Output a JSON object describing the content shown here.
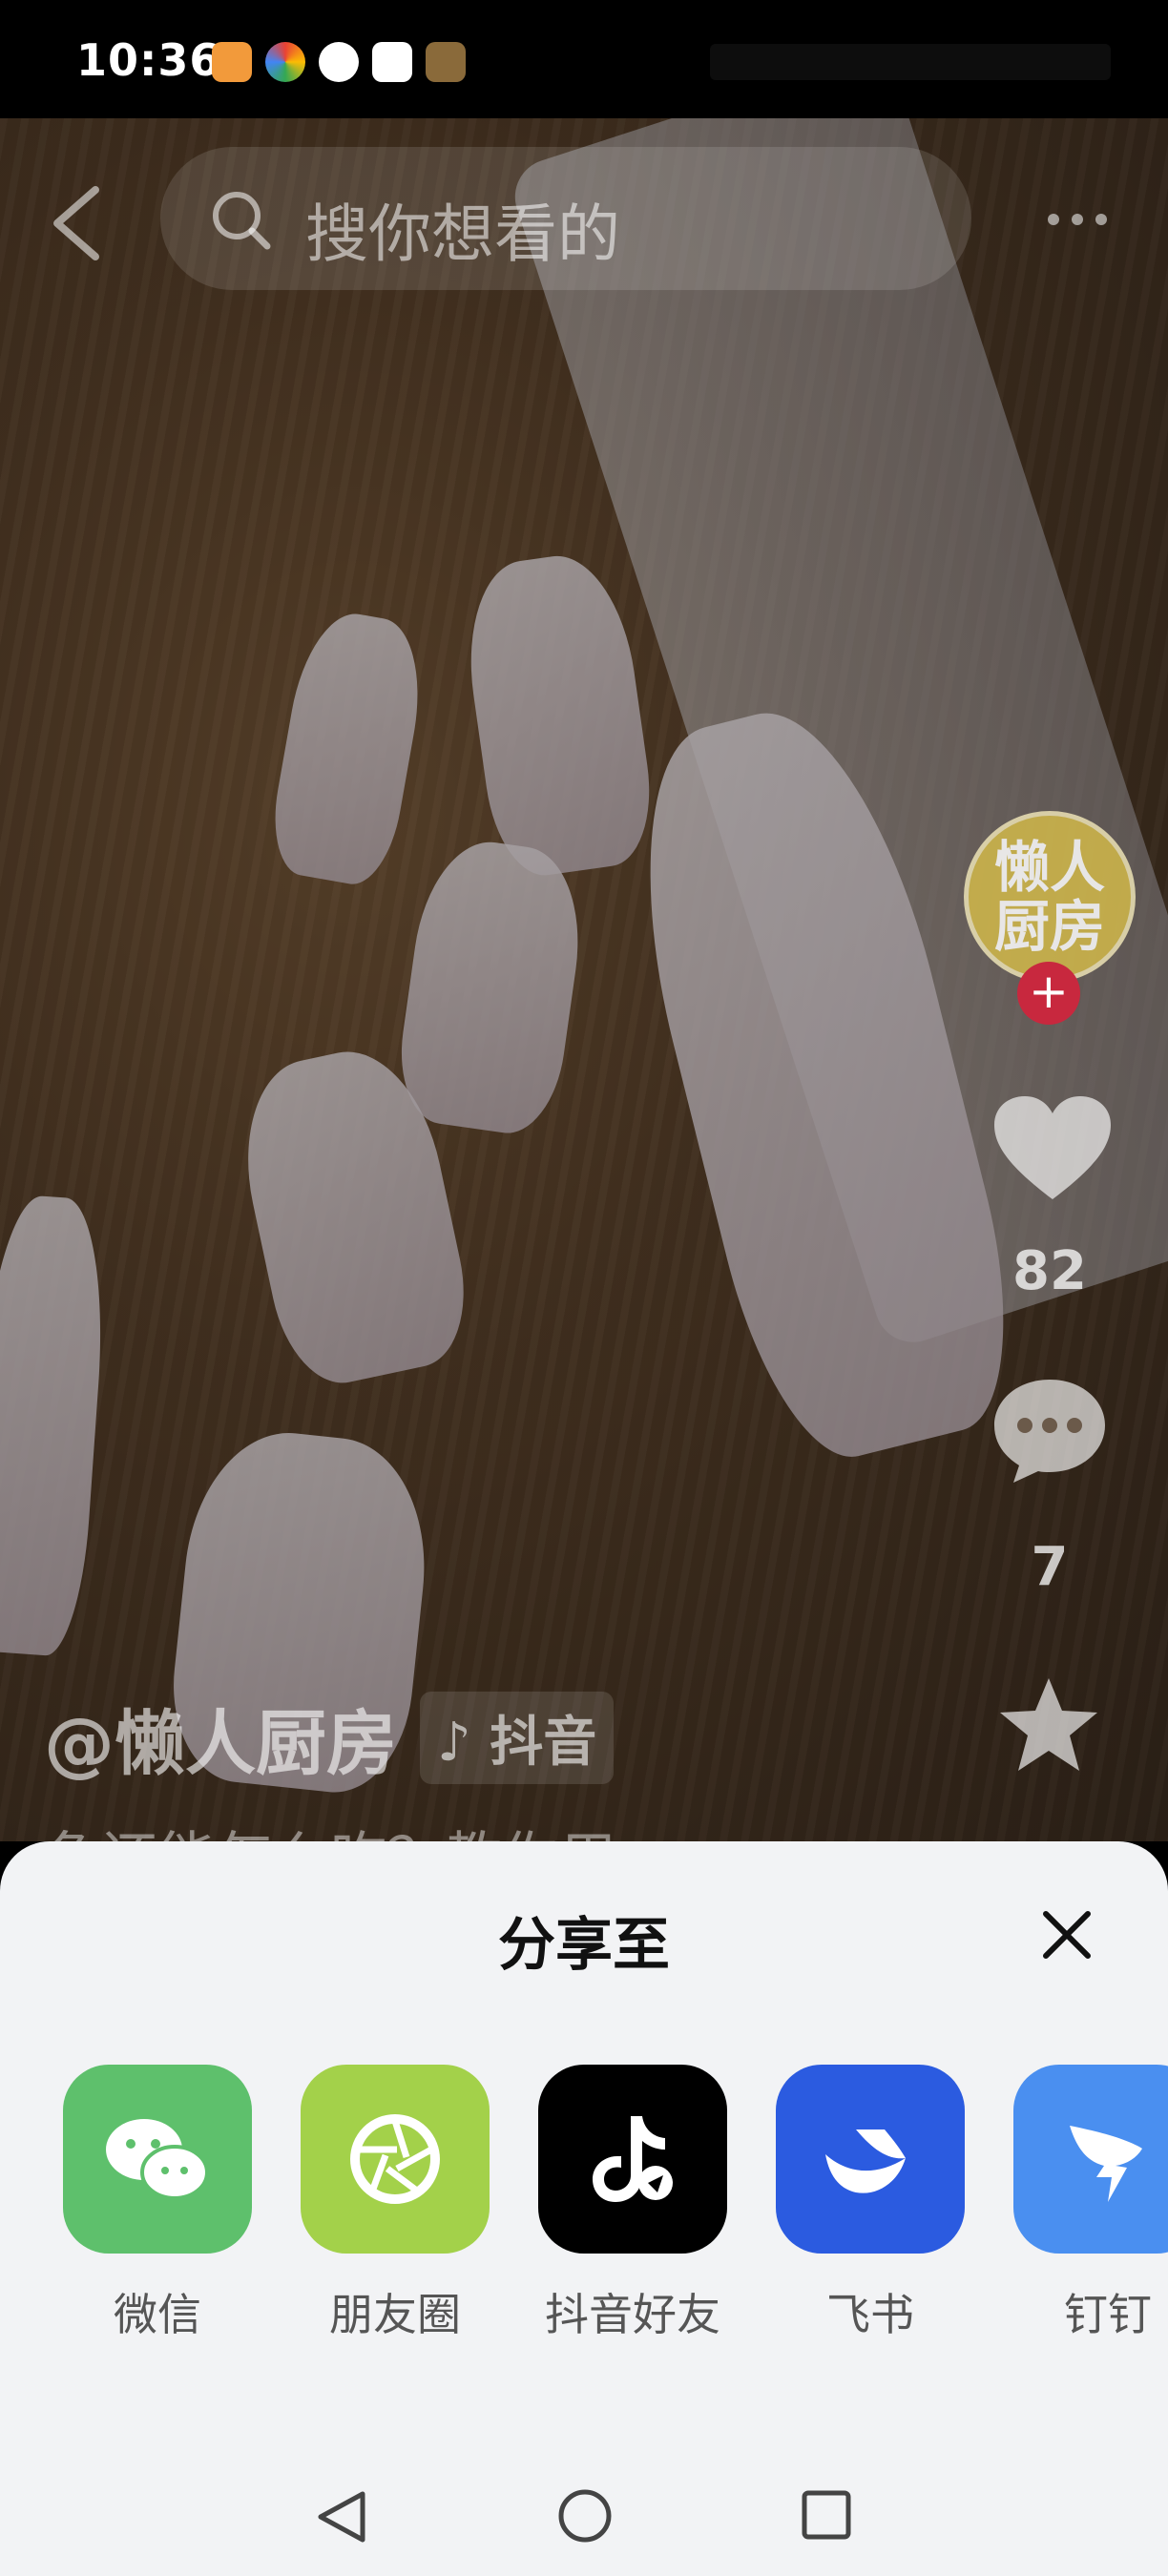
{
  "status_bar": {
    "time": "10:36"
  },
  "top_bar": {
    "search_placeholder": "搜你想看的"
  },
  "creator": {
    "avatar_text": "懒人厨房",
    "handle": "@懒人厨房",
    "platform_tag": "♪ 抖音",
    "description": "鱼还能怎么吃？教你用"
  },
  "actions": {
    "like_count": "82",
    "comment_count": "7"
  },
  "share_sheet": {
    "title": "分享至",
    "apps": [
      {
        "label": "微信",
        "color": "#5ec06c",
        "icon": "wechat-icon"
      },
      {
        "label": "朋友圈",
        "color": "#a3d14a",
        "icon": "moments-icon"
      },
      {
        "label": "抖音好友",
        "color": "#000000",
        "icon": "douyin-icon"
      },
      {
        "label": "飞书",
        "color": "#2b5be0",
        "icon": "feishu-icon"
      },
      {
        "label": "钉钉",
        "color": "#4a8ff0",
        "icon": "dingtalk-icon"
      }
    ]
  }
}
